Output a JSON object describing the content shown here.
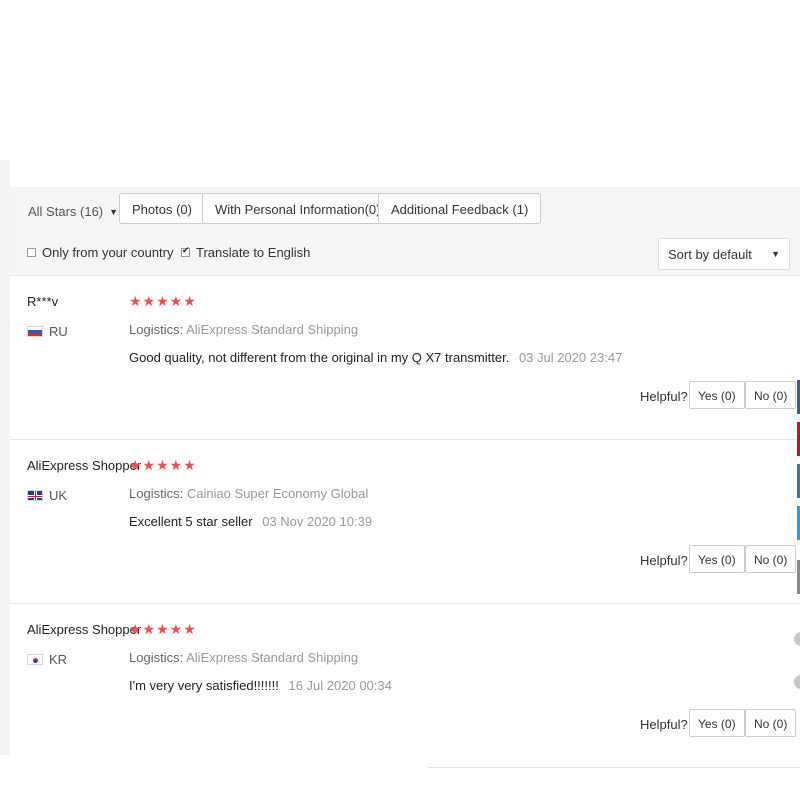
{
  "filters": {
    "stars_dropdown": "All Stars (16)",
    "buttons": [
      {
        "label": "Photos (0)"
      },
      {
        "label": "With Personal Information(0)"
      },
      {
        "label": "Additional Feedback (1)"
      }
    ],
    "only_country": {
      "label": "Only from your country",
      "checked": false
    },
    "translate": {
      "label": "Translate to English",
      "checked": true
    },
    "sort": "Sort by default"
  },
  "reviews": [
    {
      "user": "R***v",
      "country_code": "RU",
      "flag": "ru-flag",
      "rating": 5,
      "stars": "★★★★★",
      "logistics_label": "Logistics:",
      "logistics_value": "AliExpress Standard Shipping",
      "comment": "Good quality, not different from the original in my Q X7 transmitter.",
      "timestamp": "03 Jul 2020 23:47",
      "helpful_label": "Helpful?",
      "yes": "Yes (0)",
      "no": "No (0)"
    },
    {
      "user": "AliExpress Shopper",
      "country_code": "UK",
      "flag": "uk-flag",
      "rating": 5,
      "stars": "★★★★★",
      "logistics_label": "Logistics:",
      "logistics_value": "Cainiao Super Economy Global",
      "comment": "Excellent 5 star seller",
      "timestamp": "03 Nov 2020 10:39",
      "helpful_label": "Helpful?",
      "yes": "Yes (0)",
      "no": "No (0)"
    },
    {
      "user": "AliExpress Shopper",
      "country_code": "KR",
      "flag": "kr-flag",
      "rating": 5,
      "stars": "★★★★★",
      "logistics_label": "Logistics:",
      "logistics_value": "AliExpress Standard Shipping",
      "comment": "I'm very very satisfied!!!!!!!",
      "timestamp": "16 Jul 2020 00:34",
      "helpful_label": "Helpful?",
      "yes": "Yes (0)",
      "no": "No (0)"
    }
  ],
  "colors": {
    "star": "#f24d4d",
    "filter_bg": "#f5f5f5",
    "muted_text": "#999999",
    "edge_colors": [
      "#3b5998",
      "#c8102e",
      "#4a6ea9",
      "#1da1f2",
      "#888888"
    ]
  },
  "icons": [
    "chevron-down-icon",
    "checkbox-icon",
    "star-icon"
  ]
}
